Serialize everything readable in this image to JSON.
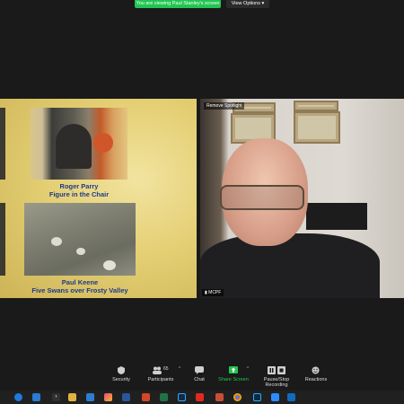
{
  "banner": {
    "viewing_text": "You are viewing Paul Stanley's screen",
    "view_options": "View Options"
  },
  "slide": {
    "captions": [
      {
        "name": "Roger Parry",
        "title": "Figure in the Chair"
      },
      {
        "name": "Paul Keene",
        "title": "Five Swans over Frosty Valley"
      }
    ]
  },
  "video": {
    "spotlight_label": "Remove Spotlight",
    "participant_name": "MCPF"
  },
  "toolbar": {
    "items": [
      {
        "label": "Security",
        "icon": "shield-icon"
      },
      {
        "label": "Participants",
        "icon": "participants-icon",
        "count": "65"
      },
      {
        "label": "Chat",
        "icon": "chat-icon"
      },
      {
        "label": "Share Screen",
        "icon": "share-screen-icon"
      },
      {
        "label": "Pause/Stop Recording",
        "icon": "recording-icon"
      },
      {
        "label": "Reactions",
        "icon": "reactions-icon"
      }
    ],
    "accent_color": "#23c552"
  },
  "taskbar": {
    "apps": [
      "edge-icon",
      "store-icon",
      "terminal-icon",
      "explorer-icon",
      "mail-icon",
      "photos-icon",
      "word-icon",
      "powerpoint-icon",
      "excel-icon",
      "lightroom-icon",
      "acrobat-icon",
      "files-icon",
      "chrome-icon",
      "photoshop-icon",
      "zoom-icon",
      "onedrive-icon"
    ]
  }
}
